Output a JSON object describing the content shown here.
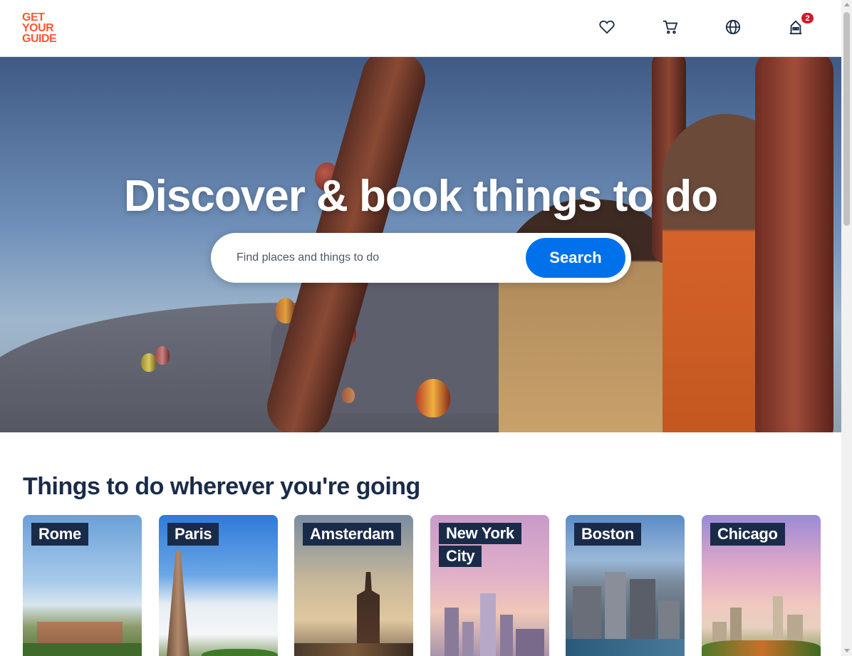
{
  "header": {
    "logo_lines": [
      "GET",
      "YOUR",
      "GUIDE"
    ],
    "icons": [
      "heart-icon",
      "cart-icon",
      "globe-icon",
      "profile-icon"
    ],
    "notification_count": "2"
  },
  "hero": {
    "title": "Discover & book things to do",
    "search_placeholder": "Find places and things to do",
    "search_button": "Search"
  },
  "section": {
    "title": "Things to do wherever you're going",
    "destinations": [
      {
        "name": "Rome"
      },
      {
        "name": "Paris"
      },
      {
        "name": "Amsterdam"
      },
      {
        "name_line1": "New York",
        "name_line2": "City"
      },
      {
        "name": "Boston"
      },
      {
        "name": "Chicago"
      }
    ]
  },
  "colors": {
    "brand": "#ff5533",
    "primary_button": "#0071eb",
    "navy": "#1a2b49",
    "badge": "#d11a2a"
  }
}
